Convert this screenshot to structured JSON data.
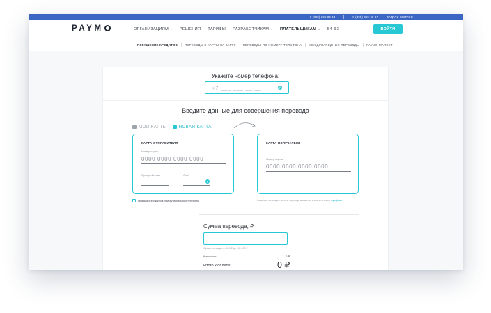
{
  "topbar": {
    "phone1": "8 (800) 301 06 44",
    "phone2": "8 (495) 369-60-67",
    "ask_label": "ЗАДАТЬ ВОПРОС"
  },
  "header": {
    "logo": "PAYMO",
    "nav": [
      {
        "label": "ОРГАНИЗАЦИЯМ",
        "dropdown": true
      },
      {
        "label": "РЕШЕНИЯ",
        "dropdown": false
      },
      {
        "label": "ТАРИФЫ",
        "dropdown": false
      },
      {
        "label": "РАЗРАБОТЧИКАМ",
        "dropdown": true
      },
      {
        "label": "ПЛАТЕЛЬЩИКАМ",
        "dropdown": true
      },
      {
        "label": "54-ФЗ",
        "dropdown": false
      }
    ],
    "login_label": "ВОЙТИ"
  },
  "subnav": {
    "items": [
      "ПОГАШЕНИЕ КРЕДИТОВ",
      "ПЕРЕВОДЫ С КАРТЫ НА КАРТУ",
      "ПЕРЕВОДЫ ПО НОМЕРУ ТЕЛЕФОНА",
      "МЕЖДУНАРОДНЫЕ ПЕРЕВОДЫ",
      "PAYMO MARKET"
    ],
    "active_index": 0
  },
  "phone_section": {
    "title": "Укажите номер телефона:",
    "placeholder": "+7 ___ ___ __ __",
    "help_glyph": "?"
  },
  "transfer": {
    "title": "Введите данные для совершения перевода",
    "tabs": [
      {
        "label": "МОИ КАРТЫ",
        "active": false
      },
      {
        "label": "НОВАЯ КАРТА",
        "active": true
      }
    ],
    "sender": {
      "title": "КАРТА ОТПРАВИТЕЛЯ",
      "number_label": "Номер карты",
      "number_placeholder": "0000 0000 0000 0000",
      "expiry_label": "Срок действия",
      "cvv_label": "CVV",
      "help_glyph": "?"
    },
    "receiver": {
      "title": "КАРТА ПОЛУЧАТЕЛЯ",
      "number_label": "Номер карты",
      "number_placeholder": "0000 0000 0000 0000"
    },
    "bind_checkbox_label": "Привязать эту карту к номеру мобильного телефона",
    "bind_checked": false,
    "fee_note": "Комиссия за осуществление перевода взимается в соответствии с",
    "fee_link": "тарифами"
  },
  "amount": {
    "title": "Сумма перевода, ₽",
    "hint": "Сумма перевода от 100 ₽ до 100 000 ₽",
    "fee_label": "Комиссия:",
    "fee_value": "0 ₽",
    "total_label": "Итого к оплате:",
    "total_value": "0 ₽"
  },
  "colors": {
    "accent": "#27c8d4",
    "topbar": "#3b66c3"
  }
}
